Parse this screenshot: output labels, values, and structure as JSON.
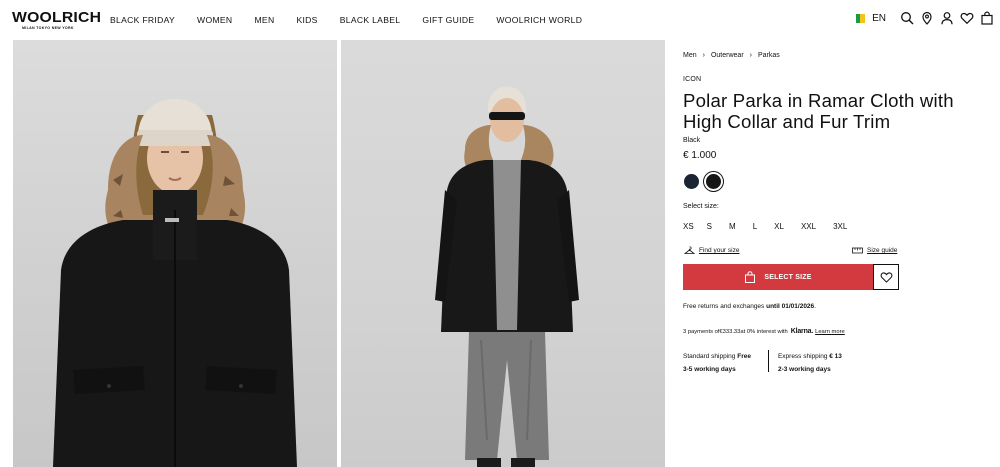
{
  "brand": {
    "logo": "WOOLRICH",
    "tagline": "MILAN TOKYO NEW YORK"
  },
  "nav": {
    "items": [
      "BLACK FRIDAY",
      "WOMEN",
      "MEN",
      "KIDS",
      "BLACK LABEL",
      "GIFT GUIDE",
      "WOOLRICH WORLD"
    ]
  },
  "header": {
    "language": "EN",
    "flag_colors": [
      "#1a9a48",
      "#f2c31c",
      "#ffffff"
    ],
    "icons": [
      "search-icon",
      "store-locator-icon",
      "account-icon",
      "wishlist-icon",
      "bag-icon"
    ]
  },
  "gallery": {
    "images": [
      "product-front-closeup-image",
      "product-full-body-image"
    ]
  },
  "product": {
    "breadcrumb": [
      "Men",
      "Outerwear",
      "Parkas"
    ],
    "badge": "ICON",
    "title": "Polar Parka in Ramar Cloth with High Collar and Fur Trim",
    "color_name": "Black",
    "price": "€ 1.000",
    "swatches": [
      {
        "color": "#1a2433",
        "selected": false
      },
      {
        "color": "#161616",
        "selected": true
      }
    ],
    "size_label": "Select size:",
    "sizes": [
      "XS",
      "S",
      "M",
      "L",
      "XL",
      "XXL",
      "3XL"
    ],
    "find_size": "Find your size",
    "size_guide": "Size guide",
    "cta_label": "SELECT SIZE",
    "cta_color": "#d23a3f",
    "returns_text": "Free returns and exchanges ",
    "returns_date": "until 01/01/2026",
    "returns_end": ".",
    "klarna": {
      "prefix": "3 payments of ",
      "amount": "€333.33",
      "middle": " at 0% interest with",
      "logo": "Klarna.",
      "link": "Learn more"
    },
    "shipping": {
      "standard_label": "Standard shipping ",
      "standard_price": "Free",
      "standard_days": "3-5 working days",
      "express_label": "Express shipping ",
      "express_price": "€ 13",
      "express_days": "2-3 working days"
    }
  }
}
